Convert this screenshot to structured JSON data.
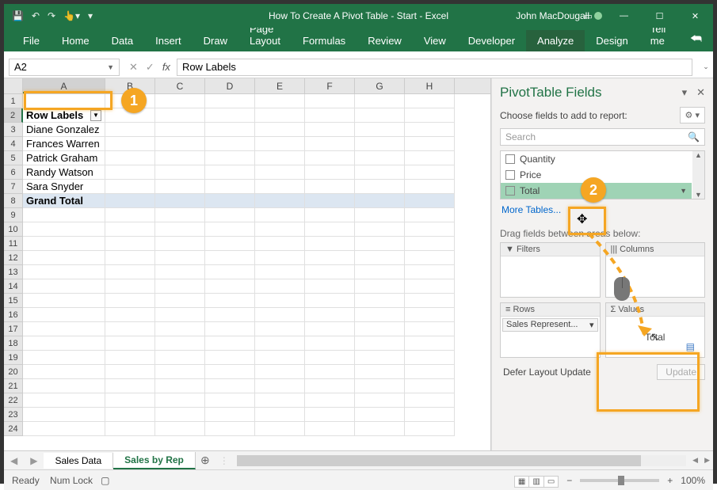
{
  "title": "How To Create A Pivot Table - Start  -  Excel",
  "user": "John MacDougall",
  "ribbon_tabs": [
    "File",
    "Home",
    "Data",
    "Insert",
    "Draw",
    "Page Layout",
    "Formulas",
    "Review",
    "View",
    "Developer",
    "Analyze",
    "Design"
  ],
  "ribbon_active": "Analyze",
  "tell_me": "Tell me",
  "namebox": "A2",
  "formula": "Row Labels",
  "columns": [
    "A",
    "B",
    "C",
    "D",
    "E",
    "F",
    "G",
    "H"
  ],
  "row_count": 24,
  "data_rows": {
    "2": {
      "A": "Row Labels",
      "filter": true
    },
    "3": {
      "A": "Diane Gonzalez"
    },
    "4": {
      "A": "Frances Warren"
    },
    "5": {
      "A": "Patrick Graham"
    },
    "6": {
      "A": "Randy Watson"
    },
    "7": {
      "A": "Sara Snyder"
    },
    "8": {
      "A": "Grand Total",
      "bold": true,
      "shade": true
    }
  },
  "sheets": [
    {
      "name": "Sales Data",
      "active": false
    },
    {
      "name": "Sales by Rep",
      "active": true
    }
  ],
  "pane": {
    "title": "PivotTable Fields",
    "subtitle": "Choose fields to add to report:",
    "search_placeholder": "Search",
    "fields": [
      {
        "name": "Quantity",
        "checked": false,
        "hl": false
      },
      {
        "name": "Price",
        "checked": false,
        "hl": false
      },
      {
        "name": "Total",
        "checked": false,
        "hl": true
      }
    ],
    "more_tables": "More Tables...",
    "drag_text": "Drag fields between areas below:",
    "areas": {
      "filters": "Filters",
      "columns": "Columns",
      "rows": "Rows",
      "values": "Values"
    },
    "rows_pill": "Sales Represent...",
    "values_pill": "Total",
    "defer": "Defer Layout Update",
    "update": "Update"
  },
  "status": {
    "ready": "Ready",
    "numlock": "Num Lock",
    "zoom": "100%"
  },
  "badges": {
    "b1": "1",
    "b2": "2"
  }
}
